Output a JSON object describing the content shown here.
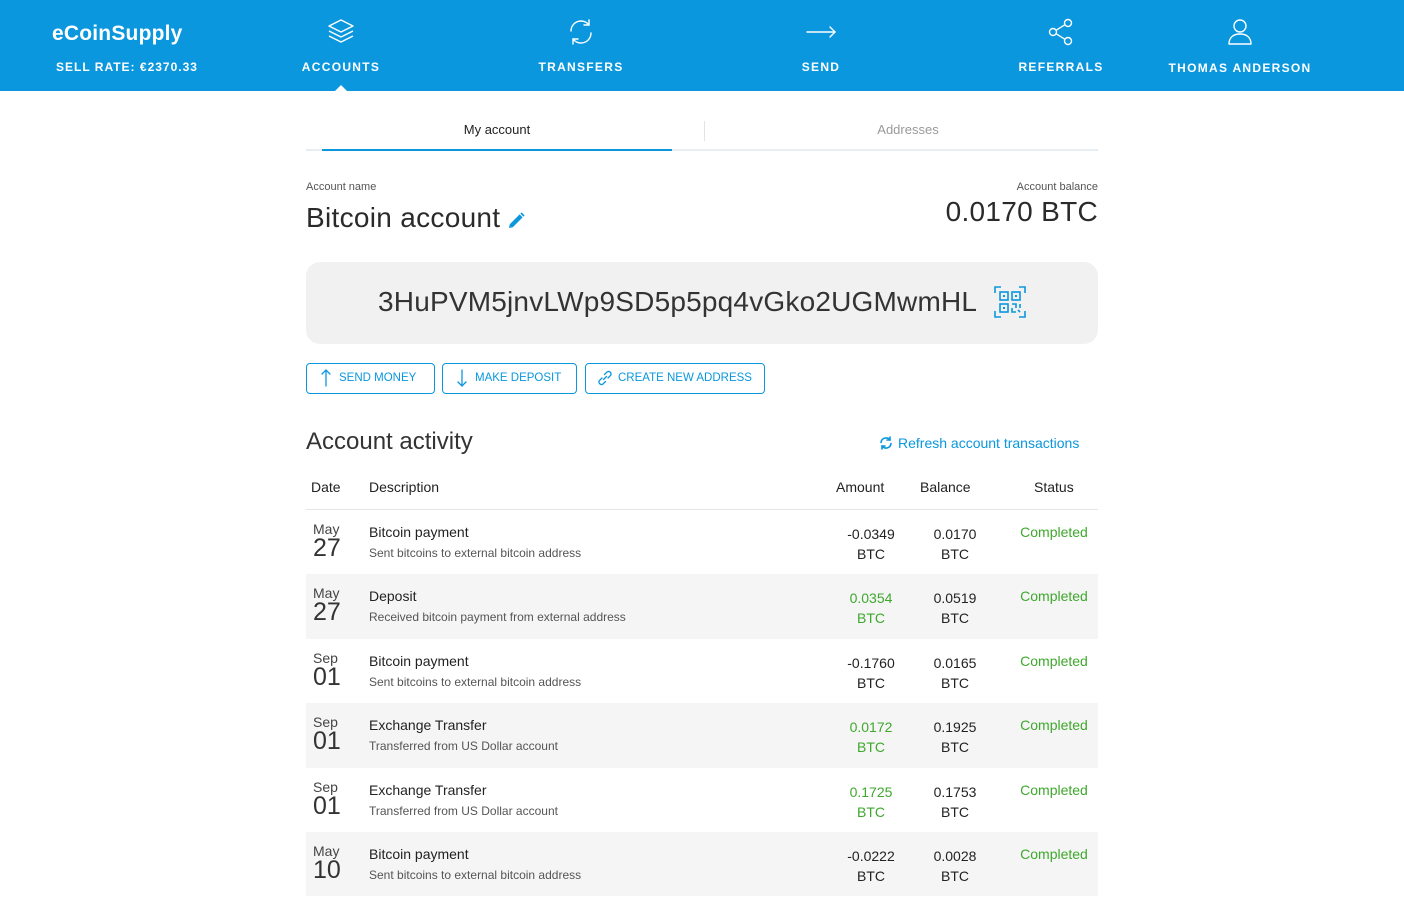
{
  "header": {
    "brand": "eCoinSupply",
    "sell_rate": "SELL RATE: €2370.33",
    "nav": [
      {
        "label": "ACCOUNTS",
        "icon": "layers-icon",
        "active": true
      },
      {
        "label": "TRANSFERS",
        "icon": "refresh-icon"
      },
      {
        "label": "SEND",
        "icon": "arrow-right-icon"
      },
      {
        "label": "REFERRALS",
        "icon": "share-icon"
      },
      {
        "label": "THOMAS ANDERSON",
        "icon": "user-icon"
      }
    ]
  },
  "tabs": {
    "my_account": "My account",
    "addresses": "Addresses"
  },
  "account": {
    "name_label": "Account name",
    "name": "Bitcoin account",
    "balance_label": "Account balance",
    "balance": "0.0170 BTC",
    "address": "3HuPVM5jnvLWp9SD5p5pq4vGko2UGMwmHL"
  },
  "actions": {
    "send_money": "SEND MONEY",
    "make_deposit": "MAKE DEPOSIT",
    "create_address": "CREATE NEW ADDRESS"
  },
  "activity": {
    "title": "Account activity",
    "refresh": "Refresh account transactions",
    "columns": {
      "date": "Date",
      "description": "Description",
      "amount": "Amount",
      "balance": "Balance",
      "status": "Status"
    },
    "rows": [
      {
        "month": "May",
        "day": "27",
        "title": "Bitcoin payment",
        "subtitle": "Sent bitcoins to external bitcoin address",
        "amount": "-0.0349",
        "amount_unit": "BTC",
        "balance": "0.0170",
        "balance_unit": "BTC",
        "status": "Completed"
      },
      {
        "month": "May",
        "day": "27",
        "title": "Deposit",
        "subtitle": "Received bitcoin payment from external address",
        "amount": "0.0354",
        "amount_unit": "BTC",
        "balance": "0.0519",
        "balance_unit": "BTC",
        "status": "Completed"
      },
      {
        "month": "Sep",
        "day": "01",
        "title": "Bitcoin payment",
        "subtitle": "Sent bitcoins to external bitcoin address",
        "amount": "-0.1760",
        "amount_unit": "BTC",
        "balance": "0.0165",
        "balance_unit": "BTC",
        "status": "Completed"
      },
      {
        "month": "Sep",
        "day": "01",
        "title": "Exchange Transfer",
        "subtitle": "Transferred from US Dollar account",
        "amount": "0.0172",
        "amount_unit": "BTC",
        "balance": "0.1925",
        "balance_unit": "BTC",
        "status": "Completed"
      },
      {
        "month": "Sep",
        "day": "01",
        "title": "Exchange Transfer",
        "subtitle": "Transferred from US Dollar account",
        "amount": "0.1725",
        "amount_unit": "BTC",
        "balance": "0.1753",
        "balance_unit": "BTC",
        "status": "Completed"
      },
      {
        "month": "May",
        "day": "10",
        "title": "Bitcoin payment",
        "subtitle": "Sent bitcoins to external bitcoin address",
        "amount": "-0.0222",
        "amount_unit": "BTC",
        "balance": "0.0028",
        "balance_unit": "BTC",
        "status": "Completed"
      }
    ]
  },
  "colors": {
    "primary": "#0a97de",
    "positive": "#3ea82d",
    "row_alt": "#f5f5f5"
  }
}
